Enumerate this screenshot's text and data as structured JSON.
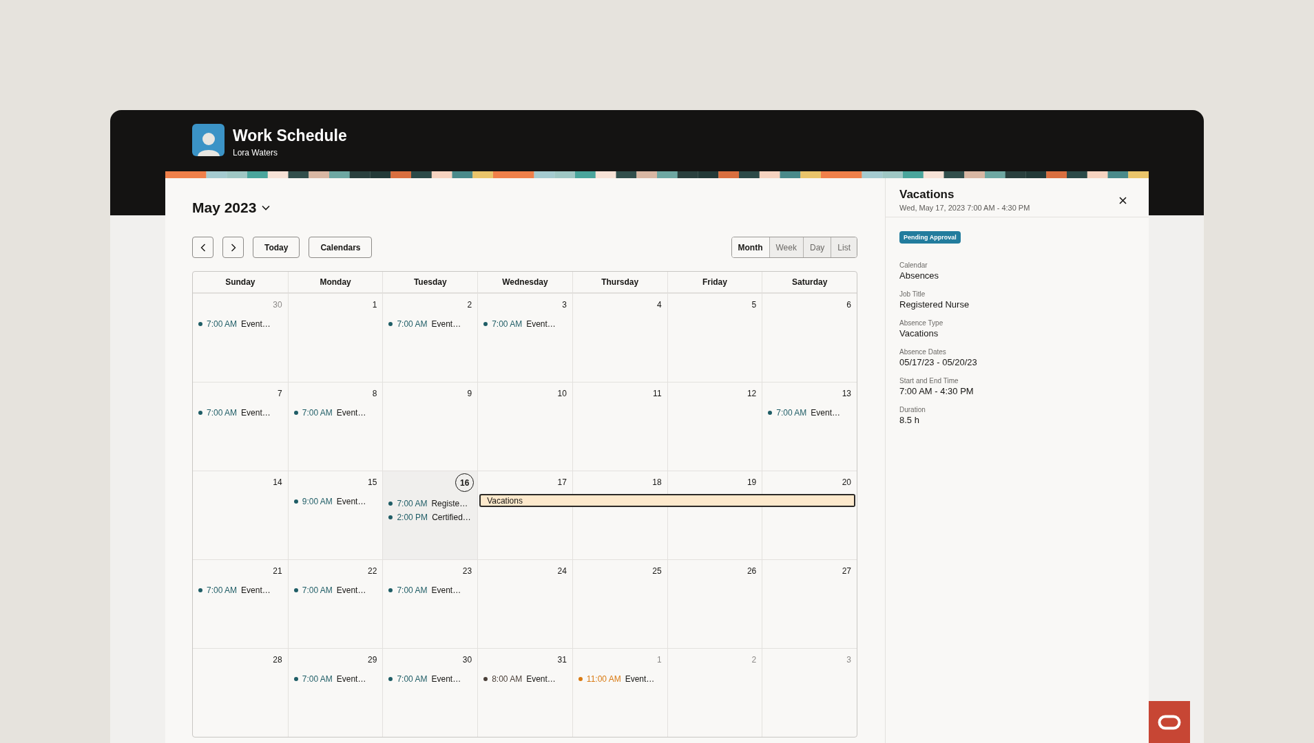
{
  "header": {
    "title": "Work Schedule",
    "subtitle": "Lora Waters"
  },
  "calendar": {
    "month_label": "May 2023",
    "toolbar": {
      "buttons": [
        {
          "kind": "prev"
        },
        {
          "kind": "next"
        },
        {
          "kind": "text",
          "label": "Today"
        },
        {
          "kind": "text",
          "label": "Calendars"
        }
      ],
      "views": [
        {
          "label": "Month",
          "selected": true
        },
        {
          "label": "Week",
          "selected": false
        },
        {
          "label": "Day",
          "selected": false
        },
        {
          "label": "List",
          "selected": false
        }
      ]
    },
    "weekdays": [
      "Sunday",
      "Monday",
      "Tuesday",
      "Wednesday",
      "Thursday",
      "Friday",
      "Saturday"
    ],
    "weeks": [
      {
        "days": [
          {
            "date": "30",
            "outside_month": true,
            "today": false,
            "events": [
              {
                "time": "7:00 AM",
                "title": "Event…",
                "color": "#1f5d66"
              }
            ]
          },
          {
            "date": "1",
            "outside_month": false,
            "today": false
          },
          {
            "date": "2",
            "outside_month": false,
            "today": false,
            "events": [
              {
                "time": "7:00 AM",
                "title": "Event…",
                "color": "#1f5d66"
              }
            ]
          },
          {
            "date": "3",
            "outside_month": false,
            "today": false,
            "events": [
              {
                "time": "7:00 AM",
                "title": "Event…",
                "color": "#1f5d66"
              }
            ]
          },
          {
            "date": "4",
            "outside_month": false,
            "today": false
          },
          {
            "date": "5",
            "outside_month": false,
            "today": false
          },
          {
            "date": "6",
            "outside_month": false,
            "today": false
          }
        ]
      },
      {
        "days": [
          {
            "date": "7",
            "outside_month": false,
            "today": false,
            "events": [
              {
                "time": "7:00 AM",
                "title": "Event…",
                "color": "#1f5d66"
              }
            ]
          },
          {
            "date": "8",
            "outside_month": false,
            "today": false,
            "events": [
              {
                "time": "7:00 AM",
                "title": "Event…",
                "color": "#1f5d66"
              }
            ]
          },
          {
            "date": "9",
            "outside_month": false,
            "today": false
          },
          {
            "date": "10",
            "outside_month": false,
            "today": false
          },
          {
            "date": "11",
            "outside_month": false,
            "today": false
          },
          {
            "date": "12",
            "outside_month": false,
            "today": false
          },
          {
            "date": "13",
            "outside_month": false,
            "today": false,
            "events": [
              {
                "time": "7:00 AM",
                "title": "Event…",
                "color": "#1f5d66"
              }
            ]
          }
        ]
      },
      {
        "days": [
          {
            "date": "14",
            "outside_month": false,
            "today": false
          },
          {
            "date": "15",
            "outside_month": false,
            "today": false,
            "events": [
              {
                "time": "9:00 AM",
                "title": "Event…",
                "color": "#1f5d66"
              }
            ]
          },
          {
            "date": "16",
            "outside_month": false,
            "today": true,
            "events": [
              {
                "time": "7:00 AM",
                "title": "Registe…",
                "color": "#1f5d66"
              },
              {
                "time": "2:00 PM",
                "title": "Certified…",
                "color": "#1f5d66"
              }
            ]
          },
          {
            "date": "17",
            "outside_month": false,
            "today": false,
            "all_day_event": {
              "label": "Vacations",
              "selected": true
            }
          },
          {
            "date": "18",
            "outside_month": false,
            "today": false,
            "all_day_event": {
              "selected": true
            }
          },
          {
            "date": "19",
            "outside_month": false,
            "today": false,
            "all_day_event": {
              "selected": true
            }
          },
          {
            "date": "20",
            "outside_month": false,
            "today": false,
            "all_day_event": {
              "selected": true
            }
          }
        ]
      },
      {
        "days": [
          {
            "date": "21",
            "outside_month": false,
            "today": false,
            "events": [
              {
                "time": "7:00 AM",
                "title": "Event…",
                "color": "#1f5d66"
              }
            ]
          },
          {
            "date": "22",
            "outside_month": false,
            "today": false,
            "events": [
              {
                "time": "7:00 AM",
                "title": "Event…",
                "color": "#1f5d66"
              }
            ]
          },
          {
            "date": "23",
            "outside_month": false,
            "today": false,
            "events": [
              {
                "time": "7:00 AM",
                "title": "Event…",
                "color": "#1f5d66"
              }
            ]
          },
          {
            "date": "24",
            "outside_month": false,
            "today": false
          },
          {
            "date": "25",
            "outside_month": false,
            "today": false
          },
          {
            "date": "26",
            "outside_month": false,
            "today": false
          },
          {
            "date": "27",
            "outside_month": false,
            "today": false
          }
        ]
      },
      {
        "days": [
          {
            "date": "28",
            "outside_month": false,
            "today": false
          },
          {
            "date": "29",
            "outside_month": false,
            "today": false,
            "events": [
              {
                "time": "7:00 AM",
                "title": "Event…",
                "color": "#1f5d66"
              }
            ]
          },
          {
            "date": "30",
            "outside_month": false,
            "today": false,
            "events": [
              {
                "time": "7:00 AM",
                "title": "Event…",
                "color": "#1f5d66"
              }
            ]
          },
          {
            "date": "31",
            "outside_month": false,
            "today": false,
            "events": [
              {
                "time": "8:00 AM",
                "title": "Event…",
                "color": "#4a3f38"
              }
            ]
          },
          {
            "date": "1",
            "outside_month": true,
            "today": false,
            "events": [
              {
                "time": "11:00 AM",
                "title": "Event…",
                "color": "#d97a12"
              }
            ]
          },
          {
            "date": "2",
            "outside_month": true,
            "today": false
          },
          {
            "date": "3",
            "outside_month": true,
            "today": false
          }
        ]
      }
    ]
  },
  "detail_panel": {
    "title": "Vacations",
    "subtitle": "Wed, May 17, 2023 7:00 AM - 4:30 PM",
    "status_badge": "Pending Approval",
    "fields": [
      {
        "label": "Calendar",
        "value": "Absences"
      },
      {
        "label": "Job Title",
        "value": "Registered Nurse"
      },
      {
        "label": "Absence Type",
        "value": "Vacations"
      },
      {
        "label": "Absence Dates",
        "value": "05/17/23 - 05/20/23"
      },
      {
        "label": "Start and End Time",
        "value": "7:00 AM - 4:30 PM"
      },
      {
        "label": "Duration",
        "value": "8.5 h"
      }
    ]
  }
}
